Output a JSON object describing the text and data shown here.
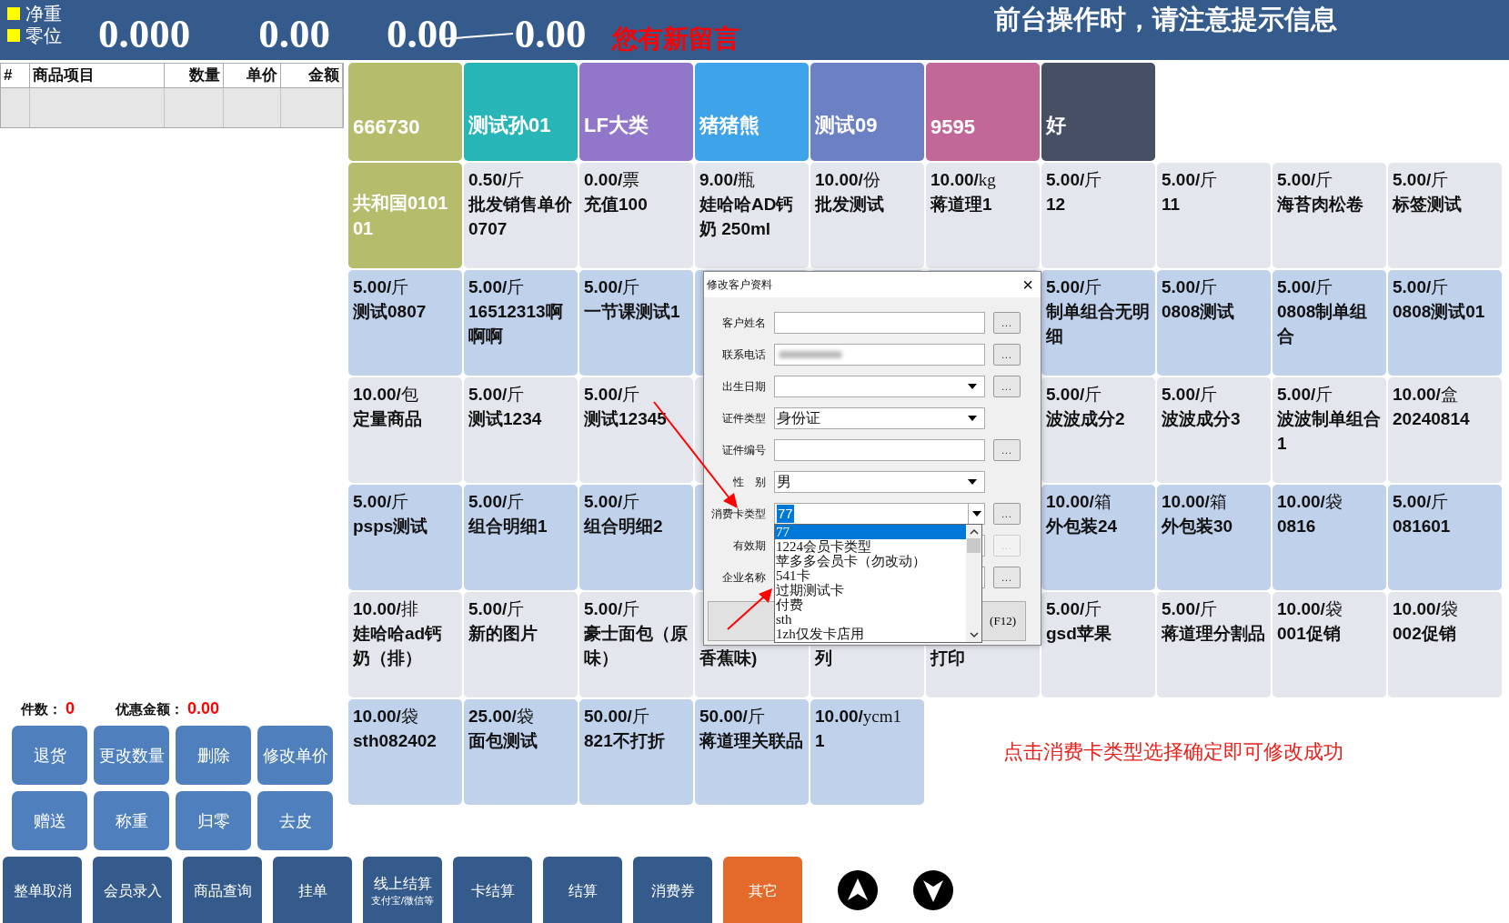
{
  "scale": {
    "labels": [
      "净重",
      "零位"
    ],
    "readings": [
      "0.000",
      "0.00",
      "0.00"
    ],
    "struck_reading": "0.00",
    "message": "您有新留言"
  },
  "notice": "前台操作时，请注意提示信息",
  "order_table": {
    "columns": [
      "#",
      "商品项目",
      "数量",
      "单价",
      "金额"
    ]
  },
  "summary": [
    {
      "label": "件数：",
      "value": "0"
    },
    {
      "label": "优惠金额：",
      "value": "0.00"
    }
  ],
  "action_buttons": [
    "退货",
    "更改数量",
    "删除",
    "修改单价",
    "赠送",
    "称重",
    "归零",
    "去皮"
  ],
  "categories": [
    {
      "name": "666730",
      "color": "#b5bd6c"
    },
    {
      "name": "测试孙01",
      "color": "#28b5b8"
    },
    {
      "name": "LF大类",
      "color": "#9276c9"
    },
    {
      "name": "猪猪熊",
      "color": "#3ea3e9"
    },
    {
      "name": "测试09",
      "color": "#6c81c4"
    },
    {
      "name": "9595",
      "color": "#c26898"
    },
    {
      "name": "好",
      "color": "#464f64"
    }
  ],
  "products": [
    {
      "kind": "category",
      "name": "共和国010101",
      "color": "#b5bd6c"
    },
    {
      "kind": "product",
      "price": "0.50/",
      "unit": "斤",
      "name": "批发销售单价0707"
    },
    {
      "kind": "product",
      "price": "0.00/",
      "unit": "票",
      "name": "充值100"
    },
    {
      "kind": "product",
      "price": "9.00/",
      "unit": "瓶",
      "name": "娃哈哈AD钙奶 250ml"
    },
    {
      "kind": "product",
      "price": "10.00/",
      "unit": "份",
      "name": "批发测试"
    },
    {
      "kind": "product",
      "price": "10.00/",
      "unit": "kg",
      "name": "蒋道理1"
    },
    {
      "kind": "product",
      "price": "5.00/",
      "unit": "斤",
      "name": "12"
    },
    {
      "kind": "product",
      "price": "5.00/",
      "unit": "斤",
      "name": "11"
    },
    {
      "kind": "product",
      "price": "5.00/",
      "unit": "斤",
      "name": "海苔肉松卷"
    },
    {
      "kind": "product",
      "price": "5.00/",
      "unit": "斤",
      "name": "标签测试"
    },
    {
      "kind": "product",
      "price": "5.00/",
      "unit": "斤",
      "name": "测试0807"
    },
    {
      "kind": "product",
      "price": "5.00/",
      "unit": "斤",
      "name": "16512313啊啊啊"
    },
    {
      "kind": "product",
      "price": "5.00/",
      "unit": "斤",
      "name": "一节课测试1"
    },
    {
      "kind": "covered"
    },
    {
      "kind": "covered"
    },
    {
      "kind": "covered"
    },
    {
      "kind": "product",
      "price": "5.00/",
      "unit": "斤",
      "name": "制单组合无明细"
    },
    {
      "kind": "product",
      "price": "5.00/",
      "unit": "斤",
      "name": "0808测试"
    },
    {
      "kind": "product",
      "price": "5.00/",
      "unit": "斤",
      "name": "0808制单组合"
    },
    {
      "kind": "product",
      "price": "5.00/",
      "unit": "斤",
      "name": "0808测试01"
    },
    {
      "kind": "product",
      "price": "10.00/",
      "unit": "包",
      "name": "定量商品"
    },
    {
      "kind": "product",
      "price": "5.00/",
      "unit": "斤",
      "name": "测试1234"
    },
    {
      "kind": "product",
      "price": "5.00/",
      "unit": "斤",
      "name": "测试12345"
    },
    {
      "kind": "covered"
    },
    {
      "kind": "hidden"
    },
    {
      "kind": "hidden"
    },
    {
      "kind": "product",
      "price": "5.00/",
      "unit": "斤",
      "name": "波波成分2"
    },
    {
      "kind": "product",
      "price": "5.00/",
      "unit": "斤",
      "name": "波波成分3"
    },
    {
      "kind": "product",
      "price": "5.00/",
      "unit": "斤",
      "name": "波波制单组合1"
    },
    {
      "kind": "product",
      "price": "10.00/",
      "unit": "盒",
      "name": "20240814"
    },
    {
      "kind": "product",
      "price": "5.00/",
      "unit": "斤",
      "name": "psps测试"
    },
    {
      "kind": "product",
      "price": "5.00/",
      "unit": "斤",
      "name": "组合明细1"
    },
    {
      "kind": "product",
      "price": "5.00/",
      "unit": "斤",
      "name": "组合明细2"
    },
    {
      "kind": "covered"
    },
    {
      "kind": "hidden"
    },
    {
      "kind": "hidden"
    },
    {
      "kind": "product",
      "price": "10.00/",
      "unit": "箱",
      "name": "外包装24"
    },
    {
      "kind": "product",
      "price": "10.00/",
      "unit": "箱",
      "name": "外包装30"
    },
    {
      "kind": "product",
      "price": "10.00/",
      "unit": "袋",
      "name": "0816"
    },
    {
      "kind": "product",
      "price": "5.00/",
      "unit": "斤",
      "name": "081601"
    },
    {
      "kind": "product",
      "price": "10.00/",
      "unit": "排",
      "name": "娃哈哈ad钙奶（排）"
    },
    {
      "kind": "product",
      "price": "5.00/",
      "unit": "斤",
      "name": "新的图片"
    },
    {
      "kind": "product",
      "price": "5.00/",
      "unit": "斤",
      "name": "豪士面包（原味）"
    },
    {
      "kind": "covered",
      "tail": "香蕉味)"
    },
    {
      "kind": "covered",
      "tail": "列"
    },
    {
      "kind": "covered",
      "tail": "打印"
    },
    {
      "kind": "product",
      "price": "5.00/",
      "unit": "斤",
      "name": "gsd苹果"
    },
    {
      "kind": "product",
      "price": "5.00/",
      "unit": "斤",
      "name": "蒋道理分割品"
    },
    {
      "kind": "product",
      "price": "10.00/",
      "unit": "袋",
      "name": "001促销"
    },
    {
      "kind": "product",
      "price": "10.00/",
      "unit": "袋",
      "name": "002促销"
    },
    {
      "kind": "product",
      "price": "10.00/",
      "unit": "袋",
      "name": "sth082402"
    },
    {
      "kind": "product",
      "price": "25.00/",
      "unit": "袋",
      "name": "面包测试"
    },
    {
      "kind": "product",
      "price": "50.00/",
      "unit": "斤",
      "name": "821不打折"
    },
    {
      "kind": "product",
      "price": "50.00/",
      "unit": "斤",
      "name": "蒋道理关联品"
    },
    {
      "kind": "product",
      "price": "10.00/",
      "unit": "ycm1",
      "name": "1"
    }
  ],
  "hint": "点击消费卡类型选择确定即可修改成功",
  "dialog": {
    "title": "修改客户资料",
    "close": "×",
    "fields": [
      {
        "label": "客户姓名",
        "kind": "text",
        "button": "..."
      },
      {
        "label": "联系电话",
        "kind": "text",
        "redacted": true,
        "button": "..."
      },
      {
        "label": "出生日期",
        "kind": "select",
        "button": "..."
      },
      {
        "label": "证件类型",
        "kind": "select",
        "value": "身份证"
      },
      {
        "label": "证件编号",
        "kind": "text",
        "button": "..."
      },
      {
        "label": "性　别",
        "kind": "select",
        "value": "男"
      },
      {
        "label": "消费卡类型",
        "kind": "combo",
        "value": "77",
        "button": "..."
      },
      {
        "label": "有效期",
        "kind": "text",
        "button": "...",
        "button_disabled": true
      },
      {
        "label": "企业名称",
        "kind": "text",
        "button": "..."
      }
    ],
    "dropdown": {
      "open": true,
      "items": [
        {
          "text": "77",
          "selected": true
        },
        {
          "text": "1224会员卡类型",
          "selected": false
        },
        {
          "text": "苹多多会员卡（勿改动）",
          "selected": false
        },
        {
          "text": "541卡",
          "selected": false
        },
        {
          "text": "过期测试卡",
          "selected": false
        },
        {
          "text": "付费",
          "selected": false
        },
        {
          "text": "sth",
          "selected": false
        },
        {
          "text": "1zh仅发卡店用",
          "selected": false
        }
      ]
    },
    "buttons": [
      {
        "kind": "blank"
      },
      {
        "kind": "labeled",
        "label": "(F12)"
      }
    ]
  },
  "toolbar": [
    {
      "label": "整单取消",
      "kind": "normal"
    },
    {
      "label": "会员录入",
      "kind": "normal"
    },
    {
      "label": "商品查询",
      "kind": "normal"
    },
    {
      "label": "挂单",
      "kind": "normal"
    },
    {
      "label": "线上结算",
      "sublabel": "支付宝/微信等",
      "kind": "normal"
    },
    {
      "label": "卡结算",
      "kind": "normal"
    },
    {
      "label": "结算",
      "kind": "normal"
    },
    {
      "label": "消费券",
      "kind": "normal"
    },
    {
      "label": "其它",
      "kind": "accent"
    }
  ],
  "nav": [
    {
      "kind": "up"
    },
    {
      "kind": "down"
    }
  ]
}
